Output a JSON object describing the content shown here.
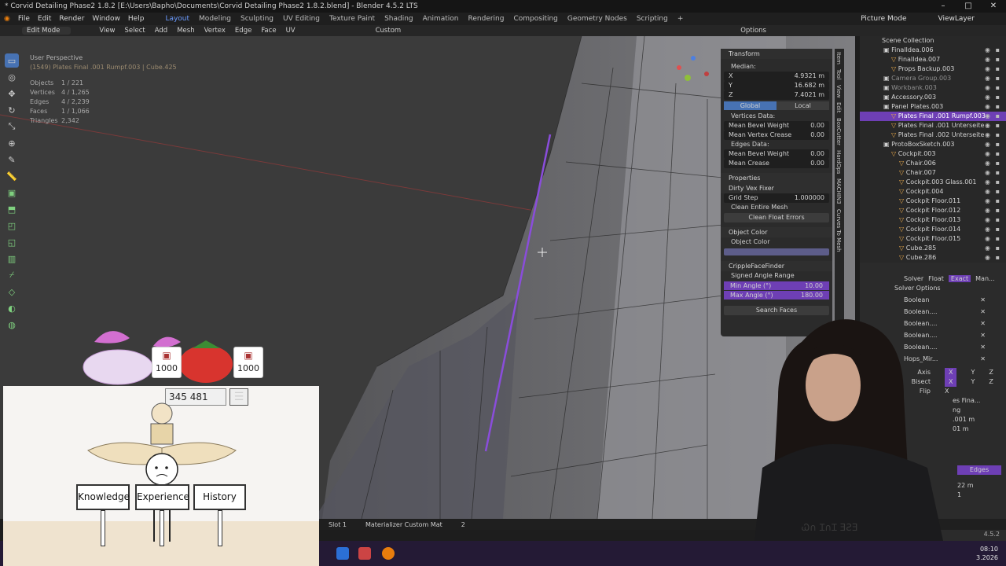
{
  "window": {
    "title": "* Corvid Detailing Phase2 1.8.2 [E:\\Users\\Bapho\\Documents\\Corvid Detailing Phase2 1.8.2.blend] - Blender 4.5.2 LTS",
    "btn_min": "–",
    "btn_max": "□",
    "btn_close": "✕"
  },
  "menu": {
    "items": [
      "File",
      "Edit",
      "Render",
      "Window",
      "Help"
    ],
    "workspaces": [
      "Layout",
      "Modeling",
      "Sculpting",
      "UV Editing",
      "Texture Paint",
      "Shading",
      "Animation",
      "Rendering",
      "Compositing",
      "Geometry Nodes",
      "Scripting"
    ],
    "active_workspace": "Layout",
    "add_tab": "+",
    "scene": "Picture Mode",
    "view_layer": "ViewLayer"
  },
  "viewport_header": {
    "mode": "Edit Mode",
    "items": [
      "View",
      "Select",
      "Add",
      "Mesh",
      "Vertex",
      "Edge",
      "Face",
      "UV"
    ],
    "orientation": "Custom",
    "options": "Options"
  },
  "viewport_info": {
    "title": "User Perspective",
    "subtitle": "(1549) Plates Final .001 Rumpf.003 | Cube.425",
    "stats": [
      {
        "k": "Objects",
        "v": "1 / 221"
      },
      {
        "k": "Vertices",
        "v": "4 / 1,265"
      },
      {
        "k": "Edges",
        "v": "4 / 2,239"
      },
      {
        "k": "Faces",
        "v": "1 / 1,066"
      },
      {
        "k": "Triangles",
        "v": "2,342"
      }
    ]
  },
  "npanel": {
    "transform": "Transform",
    "median": "Median:",
    "x": {
      "k": "X",
      "v": "4.9321 m"
    },
    "y": {
      "k": "Y",
      "v": "16.682 m"
    },
    "z": {
      "k": "Z",
      "v": "7.4021 m"
    },
    "global": "Global",
    "local": "Local",
    "vertices_data": "Vertices Data:",
    "mean_bevel_weight": {
      "k": "Mean Bevel Weight",
      "v": "0.00"
    },
    "mean_vertex_crease": {
      "k": "Mean Vertex Crease",
      "v": "0.00"
    },
    "edges_data": "Edges Data:",
    "edge_bevel_weight": {
      "k": "Mean Bevel Weight",
      "v": "0.00"
    },
    "mean_crease": {
      "k": "Mean Crease",
      "v": "0.00"
    },
    "properties": "Properties",
    "dirty_vex_fixer": "Dirty Vex Fixer",
    "grid_step": {
      "k": "Grid Step",
      "v": "1.000000"
    },
    "clean_entire_mesh": "Clean Entire Mesh",
    "clean_float_errors": "Clean Float Errors",
    "object_color_section": "Object Color",
    "object_color_label": "Object Color",
    "cripple": "CrippleFaceFinder",
    "signed_angle_range": "Signed Angle Range",
    "min_angle": {
      "k": "Min Angle (°)",
      "v": "10.00"
    },
    "max_angle": {
      "k": "Max Angle (°)",
      "v": "180.00"
    },
    "search_faces": "Search Faces"
  },
  "ntabs": [
    "Item",
    "Tool",
    "View",
    "Edit",
    "BoxCutter",
    "HardOps",
    "MACHIN3",
    "Curves To Mesh"
  ],
  "outliner": {
    "root": "Scene Collection",
    "items": [
      {
        "label": "FinalIdea.006",
        "indent": 1,
        "state": ""
      },
      {
        "label": "FinalIdea.007",
        "indent": 2,
        "state": ""
      },
      {
        "label": "Props Backup.003",
        "indent": 2,
        "state": ""
      },
      {
        "label": "Camera Group.003",
        "indent": 1,
        "state": "dim"
      },
      {
        "label": "Workbank.003",
        "indent": 1,
        "state": "dim"
      },
      {
        "label": "Accessory.003",
        "indent": 1,
        "state": ""
      },
      {
        "label": "Panel Plates.003",
        "indent": 1,
        "state": ""
      },
      {
        "label": "Plates Final .001 Rumpf.003",
        "indent": 2,
        "state": "sel"
      },
      {
        "label": "Plates Final .001 Unterseite",
        "indent": 2,
        "state": ""
      },
      {
        "label": "Plates Final .002 Unterseite",
        "indent": 2,
        "state": ""
      },
      {
        "label": "ProtoBoxSketch.003",
        "indent": 1,
        "state": ""
      },
      {
        "label": "Cockpit.003",
        "indent": 2,
        "state": ""
      },
      {
        "label": "Chair.006",
        "indent": 3,
        "state": ""
      },
      {
        "label": "Chair.007",
        "indent": 3,
        "state": ""
      },
      {
        "label": "Cockpit.003 Glass.001",
        "indent": 3,
        "state": ""
      },
      {
        "label": "Cockpit.004",
        "indent": 3,
        "state": ""
      },
      {
        "label": "Cockpit Floor.011",
        "indent": 3,
        "state": ""
      },
      {
        "label": "Cockpit Floor.012",
        "indent": 3,
        "state": ""
      },
      {
        "label": "Cockpit Floor.013",
        "indent": 3,
        "state": ""
      },
      {
        "label": "Cockpit Floor.014",
        "indent": 3,
        "state": ""
      },
      {
        "label": "Cockpit Floor.015",
        "indent": 3,
        "state": ""
      },
      {
        "label": "Cube.285",
        "indent": 3,
        "state": ""
      },
      {
        "label": "Cube.286",
        "indent": 3,
        "state": ""
      }
    ]
  },
  "properties": {
    "tabs": [
      "Solver",
      "Float",
      "Exact",
      "Man..."
    ],
    "active_tab": "Exact",
    "solver_options": "Solver Options",
    "modifiers": [
      "Boolean",
      "Boolean....",
      "Boolean....",
      "Boolean....",
      "Boolean....",
      "Hops_Mir..."
    ],
    "axis": "Axis",
    "bisect": "Bisect",
    "flip": "Flip",
    "xyz": [
      "X",
      "Y",
      "Z"
    ],
    "edges": "Edges",
    "frag1": "es Fina...",
    "frag2": "ng",
    "frag3": ".001 m",
    "frag4": "01 m",
    "frag5": "22 m",
    "frag6": "1",
    "version": "4.5.2"
  },
  "statusbar": {
    "slot": "Slot 1",
    "material": "Materializer Custom Mat",
    "num": "2"
  },
  "taskbar": {
    "time": "08:10",
    "date": "3.2026"
  },
  "overlay": {
    "counter_left": "1000",
    "counter_right": "1000",
    "score": "345 481",
    "menu_icon": "☰",
    "signs": [
      "Knowledge",
      "Experience",
      "History"
    ]
  },
  "colors": {
    "accent_purple": "#6e3fb5",
    "accent_blue": "#4772b3",
    "viewport_bg": "#3b3b3b",
    "selection_edge": "#8a4ddb"
  }
}
